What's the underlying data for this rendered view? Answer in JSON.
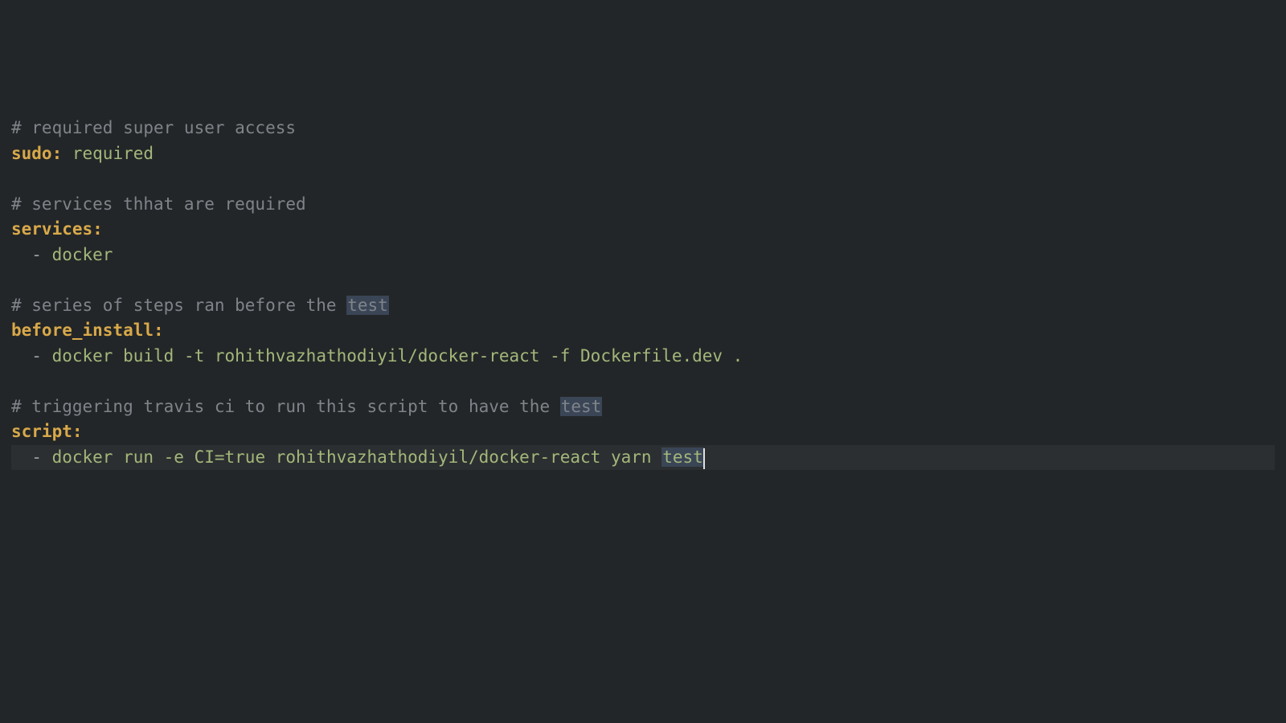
{
  "lines": {
    "comment1": "# required super user access",
    "key1": "sudo",
    "colon1": ": ",
    "value1": "required",
    "comment2": "# services thhat are required",
    "key2": "services",
    "colon2": ":",
    "indent1": "  ",
    "dash1": "- ",
    "value2": "docker",
    "comment3_a": "# series of steps ran before the ",
    "comment3_hl": "test",
    "key3": "before_install",
    "colon3": ":",
    "indent2": "  ",
    "dash2": "- ",
    "value3": "docker build -t rohithvazhathodiyil/docker-react -f Dockerfile.dev .",
    "comment4_a": "# triggering travis ci to run this script to have the ",
    "comment4_hl": "test",
    "key4": "script",
    "colon4": ":",
    "indent3": "  ",
    "dash3": "- ",
    "value4_a": "docker run -e CI=true rohithvazhathodiyil/docker-react yarn ",
    "value4_hl": "test"
  }
}
